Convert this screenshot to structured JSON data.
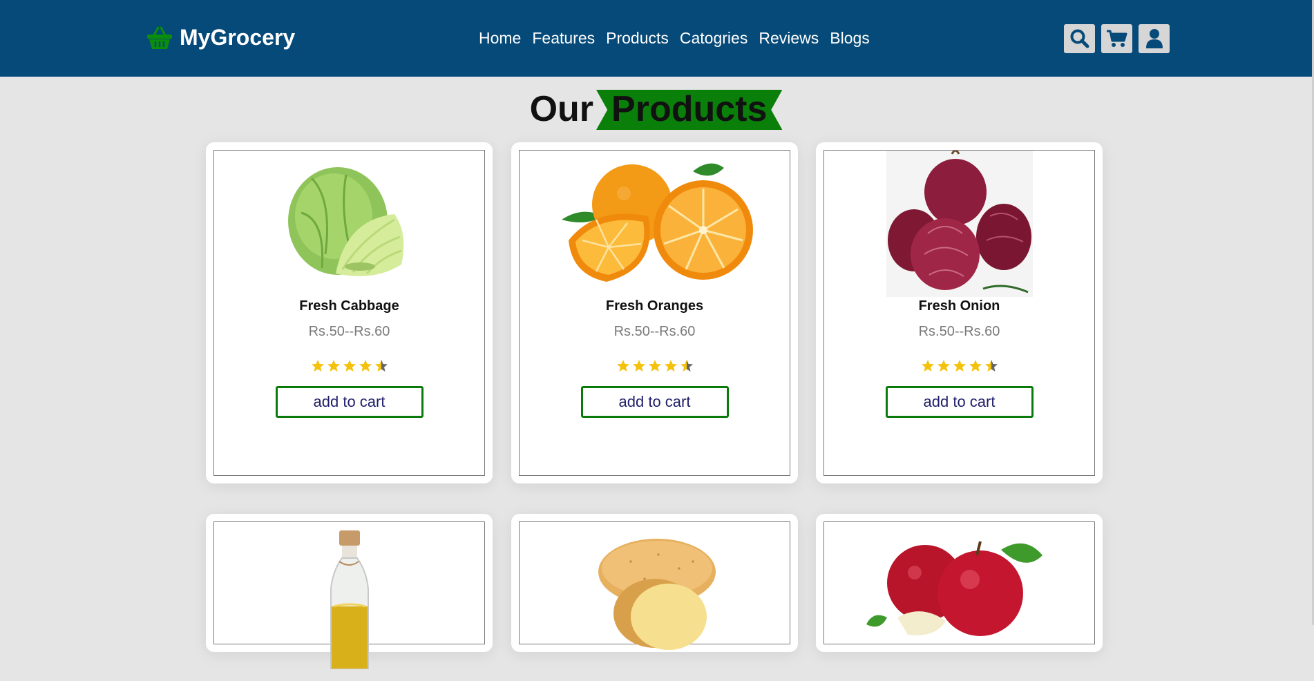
{
  "brand": {
    "name": "MyGrocery",
    "icon": "basket-icon",
    "icon_color": "#0a8f0a"
  },
  "nav": [
    {
      "label": "Home"
    },
    {
      "label": "Features"
    },
    {
      "label": "Products"
    },
    {
      "label": "Catogries"
    },
    {
      "label": "Reviews"
    },
    {
      "label": "Blogs"
    }
  ],
  "header_icons": [
    "search-icon",
    "cart-icon",
    "user-icon"
  ],
  "colors": {
    "header": "#064a79",
    "accent_green": "#0a7f0a",
    "star": "#f4c20d"
  },
  "section": {
    "title_plain": "Our",
    "title_highlight": "Products"
  },
  "products": [
    {
      "name": "Fresh Cabbage",
      "price": "Rs.50--Rs.60",
      "rating": 4.5,
      "cart_label": "add to cart",
      "image": "cabbage"
    },
    {
      "name": "Fresh Oranges",
      "price": "Rs.50--Rs.60",
      "rating": 4.5,
      "cart_label": "add to cart",
      "image": "oranges"
    },
    {
      "name": "Fresh Onion",
      "price": "Rs.50--Rs.60",
      "rating": 4.5,
      "cart_label": "add to cart",
      "image": "onions"
    },
    {
      "name": "",
      "price": "",
      "rating": null,
      "cart_label": "",
      "image": "oil-bottle"
    },
    {
      "name": "",
      "price": "",
      "rating": null,
      "cart_label": "",
      "image": "potatoes"
    },
    {
      "name": "",
      "price": "",
      "rating": null,
      "cart_label": "",
      "image": "apples"
    }
  ]
}
